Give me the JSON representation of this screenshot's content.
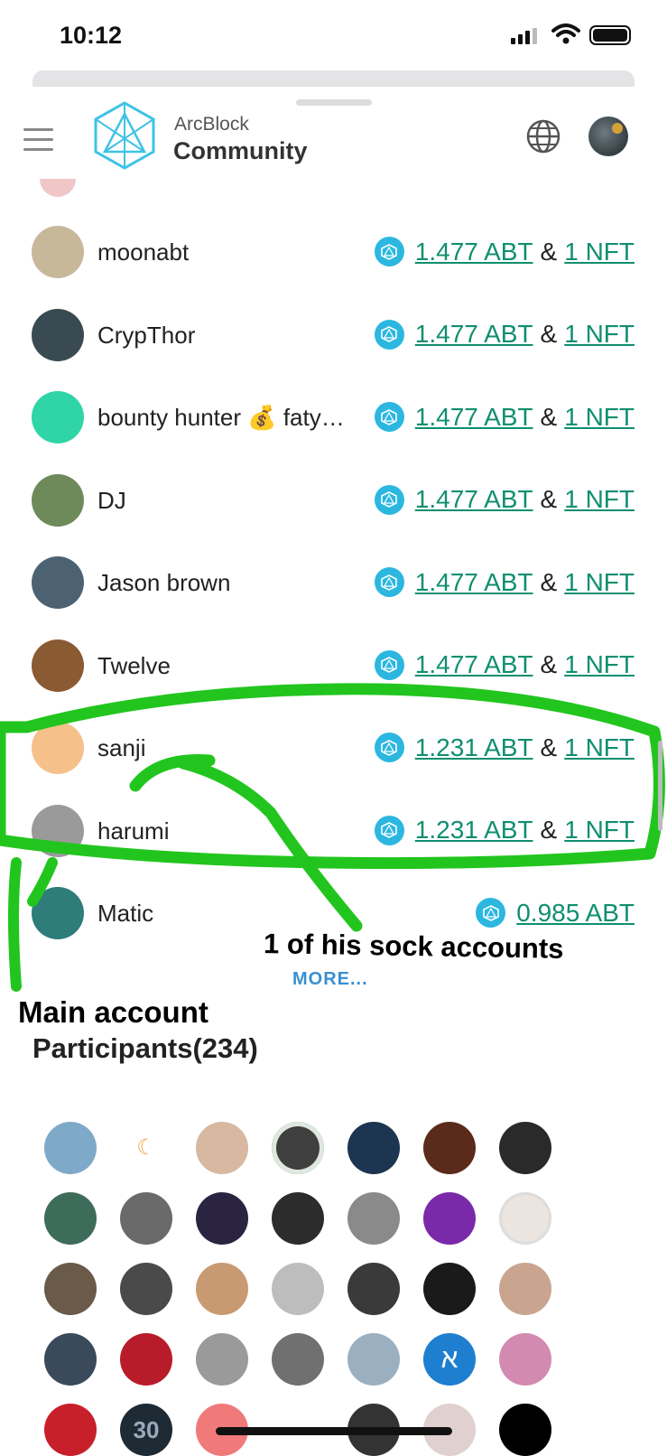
{
  "status_bar": {
    "time": "10:12"
  },
  "header": {
    "brand_line1": "ArcBlock",
    "brand_line2": "Community"
  },
  "winners": [
    {
      "name": "moonabt",
      "amount": "1.477 ABT",
      "amp": "&",
      "nft": "1 NFT",
      "avatar_color": "#c8b89a"
    },
    {
      "name": "CrypThor",
      "amount": "1.477 ABT",
      "amp": "&",
      "nft": "1 NFT",
      "avatar_color": "#3a4a52"
    },
    {
      "name": "bounty hunter 💰 faty…",
      "amount": "1.477 ABT",
      "amp": "&",
      "nft": "1 NFT",
      "avatar_color": "#2fd5a6"
    },
    {
      "name": "DJ",
      "amount": "1.477 ABT",
      "amp": "&",
      "nft": "1 NFT",
      "avatar_color": "#6f8a5a"
    },
    {
      "name": "Jason brown",
      "amount": "1.477 ABT",
      "amp": "&",
      "nft": "1 NFT",
      "avatar_color": "#4c6272"
    },
    {
      "name": "Twelve",
      "amount": "1.477 ABT",
      "amp": "&",
      "nft": "1 NFT",
      "avatar_color": "#8a5a32"
    },
    {
      "name": "sanji",
      "amount": "1.231 ABT",
      "amp": "&",
      "nft": "1 NFT",
      "avatar_color": "#f6c08a"
    },
    {
      "name": "harumi",
      "amount": "1.231 ABT",
      "amp": "&",
      "nft": "1 NFT",
      "avatar_color": "#9a9a9a"
    },
    {
      "name": "Matic",
      "amount": "0.985 ABT",
      "amp": "",
      "nft": "",
      "avatar_color": "#2e7d7a"
    }
  ],
  "more_label": "MORE...",
  "participants": {
    "title": "Participants(234)",
    "avatar_colors": [
      "#7fa9c9",
      "#ffffff",
      "#d8b8a0",
      "#3f3f3f",
      "#1c3550",
      "#5a2a1a",
      "#2a2a2a",
      "#3e6c5a",
      "#6a6a6a",
      "#2a2440",
      "#2c2c2c",
      "#8a8a8a",
      "#7a2aa8",
      "#ece4de",
      "#6a5a4a",
      "#4a4a4a",
      "#c89a72",
      "#bdbdbd",
      "#3a3a3a",
      "#1a1a1a",
      "#c9a590",
      "#3a4a5a",
      "#b81c2a",
      "#9a9a9a",
      "#707070",
      "#9ab0c0",
      "#1e7fd0",
      "#d28ab0",
      "#c8202a",
      "#1e2a34",
      "#f07a7a",
      "#ffffff",
      "#333333",
      "#e0d0d0",
      "#000000"
    ],
    "glyphs": {
      "moon": "☾",
      "aleph": "א",
      "thirty": "30"
    }
  },
  "annotations": {
    "sock_label": "1 of his sock accounts",
    "main_label": "Main account",
    "color": "#22c51e"
  }
}
